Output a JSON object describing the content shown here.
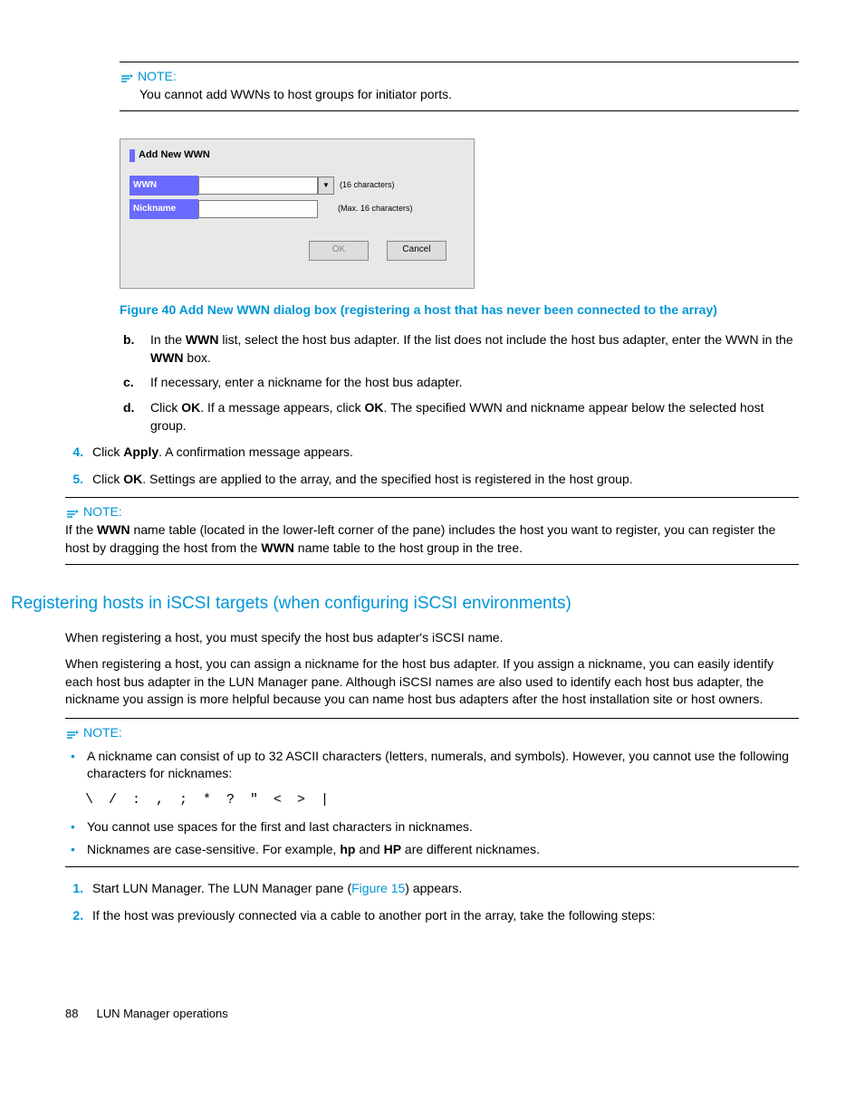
{
  "note1": {
    "label": "NOTE:",
    "body": "You cannot add WWNs to host groups for initiator ports."
  },
  "dialog": {
    "title": "Add New WWN",
    "wwn_label": "WWN",
    "wwn_suffix": "(16 characters)",
    "nick_label": "Nickname",
    "nick_suffix": "(Max. 16 characters)",
    "ok": "OK",
    "cancel": "Cancel"
  },
  "figure_caption": "Figure 40 Add New WWN dialog box (registering a host that has never been connected to the array)",
  "steps_b": {
    "marker": "b.",
    "pre": "In the ",
    "b1": "WWN",
    "mid1": " list, select the host bus adapter. If the list does not include the host bus adapter, enter the WWN in the ",
    "b2": "WWN",
    "post": " box."
  },
  "steps_c": {
    "marker": "c.",
    "text": "If necessary, enter a nickname for the host bus adapter."
  },
  "steps_d": {
    "marker": "d.",
    "pre": "Click ",
    "b1": "OK",
    "mid": ". If a message appears, click ",
    "b2": "OK",
    "post": ". The specified WWN and nickname appear below the selected host group."
  },
  "step4": {
    "marker": "4.",
    "pre": "Click ",
    "b1": "Apply",
    "post": ". A confirmation message appears."
  },
  "step5": {
    "marker": "5.",
    "pre": "Click ",
    "b1": "OK",
    "post": ". Settings are applied to the array, and the specified host is registered in the host group."
  },
  "note2": {
    "label": "NOTE:",
    "pre": "If the ",
    "b1": "WWN",
    "mid1": " name table (located in the lower-left corner of the pane) includes the host you want to register, you can register the host by dragging the host from the ",
    "b2": "WWN",
    "mid2": " name table to the host group in the tree."
  },
  "section_title": "Registering hosts in iSCSI targets (when configuring iSCSI environments)",
  "para1": "When registering a host, you must specify the host bus adapter's iSCSI name.",
  "para2": "When registering a host, you can assign a nickname for the host bus adapter. If you assign a nickname, you can easily identify each host bus adapter in the LUN Manager pane. Although iSCSI names are also used to identify each host bus adapter, the nickname you assign is more helpful because you can name host bus adapters after the host installation site or host owners.",
  "note3": {
    "label": "NOTE:",
    "bullet1": "A nickname can consist of up to 32 ASCII characters (letters, numerals, and symbols). However, you cannot use the following characters for nicknames:",
    "chars": "\\ / : , ; * ? \" < > |",
    "bullet2": "You cannot use spaces for the first and last characters in nicknames.",
    "bullet3_pre": "Nicknames are case-sensitive. For example, ",
    "bullet3_b1": "hp",
    "bullet3_mid": " and ",
    "bullet3_b2": "HP",
    "bullet3_post": " are different nicknames."
  },
  "num1": {
    "marker": "1.",
    "pre": "Start LUN Manager. The LUN Manager pane (",
    "link": "Figure 15",
    "post": ") appears."
  },
  "num2": {
    "marker": "2.",
    "text": "If the host was previously connected via a cable to another port in the array, take the following steps:"
  },
  "footer": {
    "page": "88",
    "label": "LUN Manager operations"
  }
}
